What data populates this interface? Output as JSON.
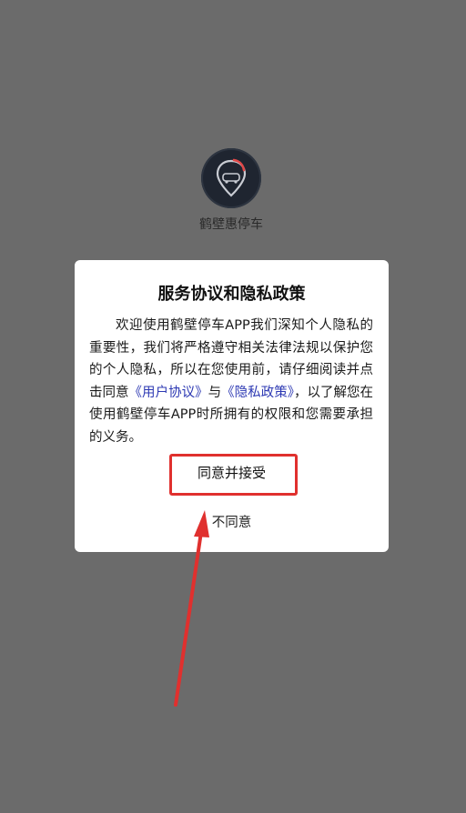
{
  "app": {
    "name": "鹤壁惠停车",
    "icon": "parking-location-pin-icon"
  },
  "dialog": {
    "title": "服务协议和隐私政策",
    "body_part1": "欢迎使用鹤壁停车APP我们深知个人隐私的重要性，我们将严格遵守相关法律法规以保护您的个人隐私，所以在您使用前，请仔细阅读并点击同意",
    "link_user_agreement": "《用户协议》",
    "body_connector": "与",
    "link_privacy_policy": "《隐私政策》",
    "body_part2": "，以了解您在使用鹤壁停车APP时所拥有的权限和您需要承担的义务。",
    "accept_label": "同意并接受",
    "reject_label": "不同意"
  },
  "annotation": {
    "highlight_color": "#e0302e"
  },
  "colors": {
    "overlay": "#6b6b6b",
    "link": "#2d39b3",
    "dialog_bg": "#ffffff"
  }
}
